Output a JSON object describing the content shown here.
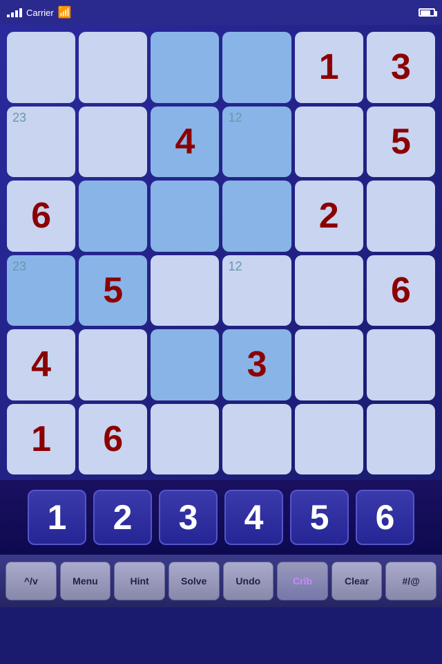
{
  "statusBar": {
    "carrier": "Carrier",
    "wifi": true,
    "battery": "battery"
  },
  "grid": {
    "cells": [
      {
        "row": 0,
        "col": 0,
        "value": "",
        "style": "light",
        "small": ""
      },
      {
        "row": 0,
        "col": 1,
        "value": "",
        "style": "light",
        "small": ""
      },
      {
        "row": 0,
        "col": 2,
        "value": "",
        "style": "blue",
        "small": ""
      },
      {
        "row": 0,
        "col": 3,
        "value": "",
        "style": "blue",
        "small": ""
      },
      {
        "row": 0,
        "col": 4,
        "value": "1",
        "style": "light",
        "small": ""
      },
      {
        "row": 0,
        "col": 5,
        "value": "3",
        "style": "light",
        "small": ""
      },
      {
        "row": 1,
        "col": 0,
        "value": "",
        "style": "light",
        "small": "23"
      },
      {
        "row": 1,
        "col": 1,
        "value": "",
        "style": "light",
        "small": ""
      },
      {
        "row": 1,
        "col": 2,
        "value": "4",
        "style": "blue",
        "small": ""
      },
      {
        "row": 1,
        "col": 3,
        "value": "",
        "style": "blue",
        "small": "12"
      },
      {
        "row": 1,
        "col": 4,
        "value": "",
        "style": "light",
        "small": ""
      },
      {
        "row": 1,
        "col": 5,
        "value": "5",
        "style": "light",
        "small": ""
      },
      {
        "row": 2,
        "col": 0,
        "value": "6",
        "style": "light",
        "small": ""
      },
      {
        "row": 2,
        "col": 1,
        "value": "",
        "style": "blue",
        "small": ""
      },
      {
        "row": 2,
        "col": 2,
        "value": "",
        "style": "blue",
        "small": ""
      },
      {
        "row": 2,
        "col": 3,
        "value": "",
        "style": "blue",
        "small": ""
      },
      {
        "row": 2,
        "col": 4,
        "value": "2",
        "style": "light",
        "small": ""
      },
      {
        "row": 2,
        "col": 5,
        "value": "",
        "style": "light",
        "small": ""
      },
      {
        "row": 3,
        "col": 0,
        "value": "",
        "style": "blue",
        "small": "23"
      },
      {
        "row": 3,
        "col": 1,
        "value": "5",
        "style": "blue",
        "small": ""
      },
      {
        "row": 3,
        "col": 2,
        "value": "",
        "style": "light",
        "small": ""
      },
      {
        "row": 3,
        "col": 3,
        "value": "",
        "style": "light",
        "small": "12"
      },
      {
        "row": 3,
        "col": 4,
        "value": "",
        "style": "light",
        "small": ""
      },
      {
        "row": 3,
        "col": 5,
        "value": "6",
        "style": "light",
        "small": ""
      },
      {
        "row": 4,
        "col": 0,
        "value": "4",
        "style": "light",
        "small": ""
      },
      {
        "row": 4,
        "col": 1,
        "value": "",
        "style": "light",
        "small": ""
      },
      {
        "row": 4,
        "col": 2,
        "value": "",
        "style": "blue",
        "small": ""
      },
      {
        "row": 4,
        "col": 3,
        "value": "3",
        "style": "blue",
        "small": ""
      },
      {
        "row": 4,
        "col": 4,
        "value": "",
        "style": "light",
        "small": ""
      },
      {
        "row": 4,
        "col": 5,
        "value": "",
        "style": "light",
        "small": ""
      },
      {
        "row": 5,
        "col": 0,
        "value": "1",
        "style": "light",
        "small": ""
      },
      {
        "row": 5,
        "col": 1,
        "value": "6",
        "style": "light",
        "small": ""
      },
      {
        "row": 5,
        "col": 2,
        "value": "",
        "style": "light",
        "small": ""
      },
      {
        "row": 5,
        "col": 3,
        "value": "",
        "style": "light",
        "small": ""
      },
      {
        "row": 5,
        "col": 4,
        "value": "",
        "style": "light",
        "small": ""
      },
      {
        "row": 5,
        "col": 5,
        "value": "",
        "style": "light",
        "small": ""
      }
    ]
  },
  "numberPad": {
    "buttons": [
      "1",
      "2",
      "3",
      "4",
      "5",
      "6"
    ]
  },
  "toolbar": {
    "buttons": [
      {
        "label": "^/v",
        "name": "toggle-button"
      },
      {
        "label": "Menu",
        "name": "menu-button"
      },
      {
        "label": "Hint",
        "name": "hint-button"
      },
      {
        "label": "Solve",
        "name": "solve-button"
      },
      {
        "label": "Undo",
        "name": "undo-button"
      },
      {
        "label": "Crib",
        "name": "crib-button",
        "special": "crib"
      },
      {
        "label": "Clear",
        "name": "clear-button"
      },
      {
        "label": "#/@",
        "name": "symbol-button"
      }
    ]
  }
}
